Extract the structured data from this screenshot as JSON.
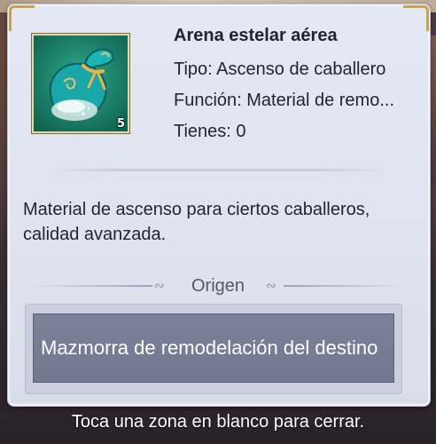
{
  "item": {
    "name": "Arena estelar aérea",
    "type_line": "Tipo: Ascenso de caballero",
    "function_line": "Función: Material de remo...",
    "owned_line": "Tienes: 0",
    "count_badge": "5",
    "icon": "star-sand-pouch-icon"
  },
  "description": "Material de ascenso para ciertos caballeros, calidad avanzada.",
  "origin": {
    "title": "Origen",
    "sources": [
      "Mazmorra de remodelación del destino"
    ]
  },
  "close_hint": "Toca una zona en blanco para cerrar.",
  "colors": {
    "panel_bg": "#e4e8f2",
    "text": "#1f2430",
    "source_button_bg": "#7b8199",
    "icon_bg": "#1b7e66",
    "frame_gold": "#c9a24e"
  }
}
